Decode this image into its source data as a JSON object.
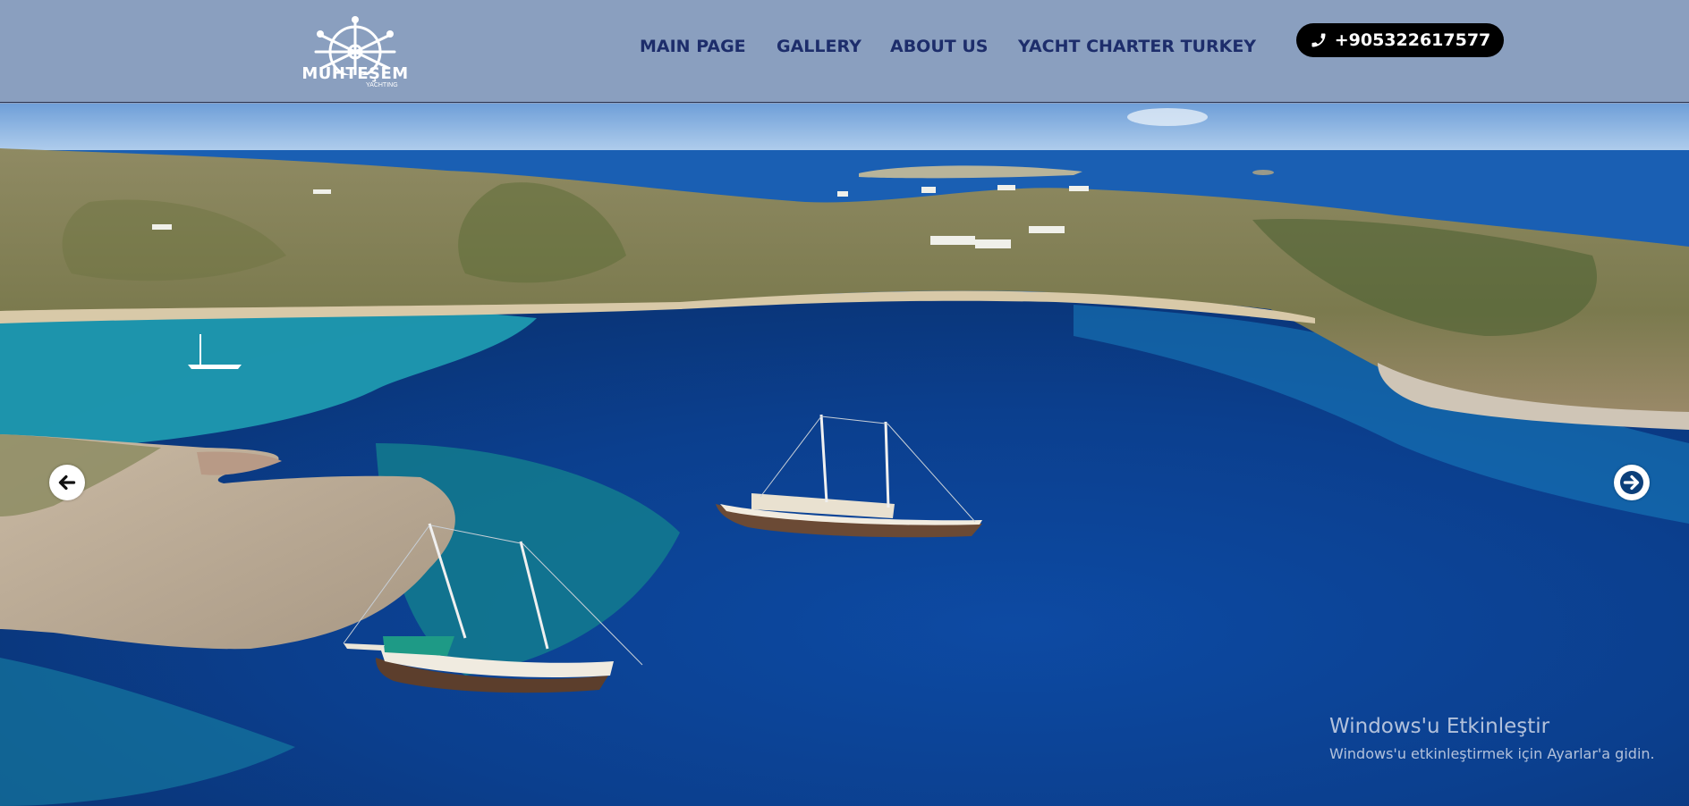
{
  "brand": {
    "logo_text": "MUHTEŞEM",
    "logo_subtext": "YACHTING",
    "logo_icon": "ship-wheel-icon"
  },
  "nav": {
    "items": [
      {
        "label": "MAIN PAGE"
      },
      {
        "label": "GALLERY"
      },
      {
        "label": "ABOUT US"
      },
      {
        "label": "YACHT CHARTER TURKEY"
      }
    ]
  },
  "contact": {
    "phone": "+905322617577",
    "icon": "phone-icon"
  },
  "slider": {
    "prev_icon": "arrow-left-icon",
    "next_icon": "arrow-right-icon"
  },
  "watermark": {
    "title": "Windows'u Etkinleştir",
    "subtitle": "Windows'u etkinleştirmek için Ayarlar'a gidin."
  },
  "colors": {
    "header_bg": "#8a9fbf",
    "nav_text": "#1d2d6b",
    "phone_bg": "#000000",
    "sea_deep": "#0a3f8f",
    "sea_turquoise": "#1fa7b5"
  }
}
